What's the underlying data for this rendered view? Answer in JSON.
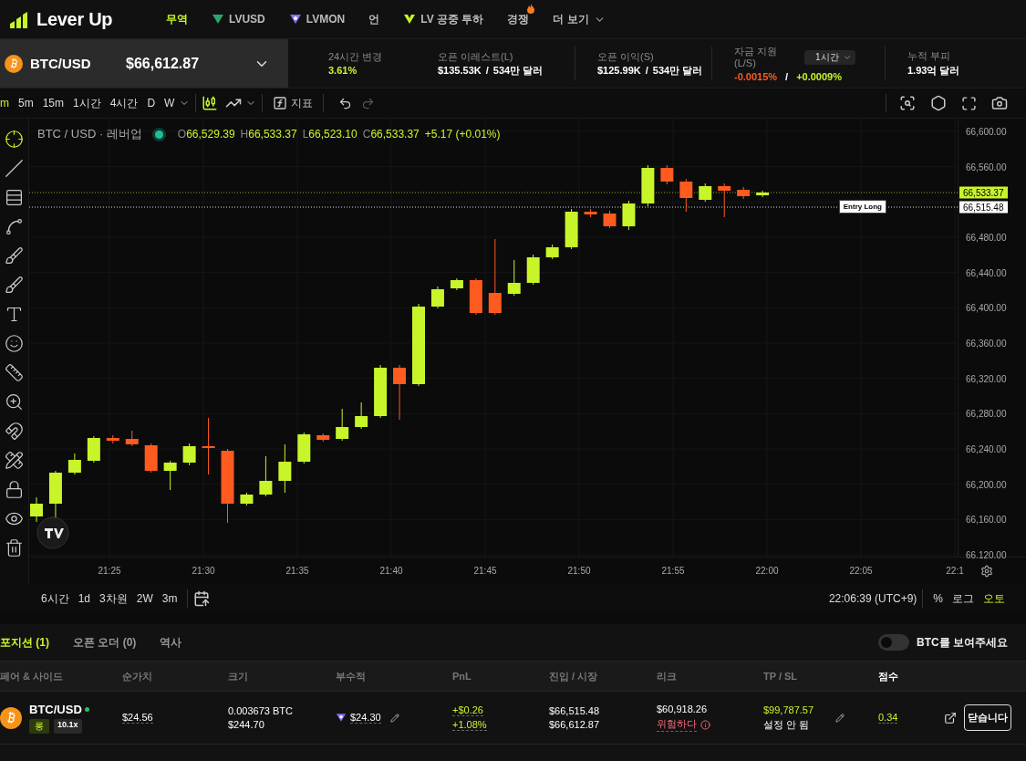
{
  "brand": {
    "name": "Lever Up"
  },
  "nav": [
    {
      "label": "무역",
      "kind": "text",
      "selected": true
    },
    {
      "label": "LVUSD",
      "kind": "usd-token",
      "selected": false
    },
    {
      "label": "LVMON",
      "kind": "mon-token",
      "selected": false
    },
    {
      "label": "언",
      "kind": "text",
      "selected": false
    },
    {
      "label": "LV 공중 투하",
      "kind": "airdrop",
      "selected": false
    },
    {
      "label": "경쟁",
      "kind": "hot",
      "selected": false
    },
    {
      "label": "더 보기",
      "kind": "menu",
      "selected": false
    }
  ],
  "ticker": {
    "pair": "BTC/USD",
    "price": "$66,612.87"
  },
  "stats": [
    {
      "kind": "change",
      "label": "24시간 변경",
      "value": "3.61%"
    },
    {
      "kind": "ratio",
      "label": "오픈 이레스트(L)",
      "value": "$135.53K",
      "sep": "/",
      "total": "534만 달러"
    },
    {
      "kind": "ratio",
      "label": "오픈 이익(S)",
      "value": "$125.99K",
      "sep": "/",
      "total": "534만 달러"
    },
    {
      "kind": "funding",
      "label": "자금 지원 (L/S)",
      "select": "1시간",
      "long": "-0.0015%",
      "sep": "/",
      "short": "+0.0009%"
    },
    {
      "kind": "plain",
      "label": "누적 부피",
      "value": "1.93억 달러"
    }
  ],
  "toolbar": {
    "intervals": [
      {
        "label": "m",
        "selected": true
      },
      {
        "label": "5m",
        "selected": false
      },
      {
        "label": "15m",
        "selected": false
      },
      {
        "label": "1시간",
        "selected": false
      },
      {
        "label": "4시간",
        "selected": false
      },
      {
        "label": "D",
        "selected": false
      },
      {
        "label": "W",
        "selected": false
      }
    ],
    "indicators": "지표"
  },
  "chart": {
    "title": "BTC / USD · 레버업",
    "ohlc": [
      {
        "key": "O",
        "value": "66,529.39"
      },
      {
        "key": "H",
        "value": "66,533.37"
      },
      {
        "key": "L",
        "value": "66,523.10"
      },
      {
        "key": "C",
        "value": "66,533.37"
      }
    ],
    "change": "+5.17 (+0.01%)",
    "price_labels": [
      "66,600.00",
      "66,560.00",
      "66,480.00",
      "66,440.00",
      "66,400.00",
      "66,360.00",
      "66,320.00",
      "66,280.00",
      "66,240.00",
      "66,200.00",
      "66,160.00",
      "66.120.00"
    ],
    "price_tags": [
      {
        "kind": "last",
        "value": "66,533.37"
      },
      {
        "kind": "entry",
        "value": "66,515.48"
      }
    ],
    "entry_label": "Entry Long",
    "time_labels": [
      "21:25",
      "21:30",
      "21:35",
      "21:40",
      "21:45",
      "21:50",
      "21:55",
      "22:00",
      "22:05",
      "22:1"
    ]
  },
  "range_bar": {
    "ranges": [
      "6시간",
      "1d",
      "3차원",
      "2W",
      "3m"
    ],
    "clock": "22:06:39 (UTC+9)",
    "options": [
      {
        "label": "%",
        "selected": false
      },
      {
        "label": "로그",
        "selected": false
      },
      {
        "label": "오토",
        "selected": true
      }
    ]
  },
  "positions": {
    "tabs": [
      {
        "label": "포지션 (1)",
        "selected": true
      },
      {
        "label": "오픈 오더 (0)",
        "selected": false
      },
      {
        "label": "역사",
        "selected": false
      }
    ],
    "toggle": {
      "label": "BTC를 보여주세요",
      "on": false
    },
    "columns": [
      {
        "label": "페어 & 사이드",
        "sorted": false
      },
      {
        "label": "순가치",
        "sorted": false
      },
      {
        "label": "크기",
        "sorted": false
      },
      {
        "label": "부수적",
        "sorted": false
      },
      {
        "label": "PnL",
        "sorted": false
      },
      {
        "label": "진입 / 시장",
        "sorted": false
      },
      {
        "label": "리크",
        "sorted": false
      },
      {
        "label": "TP / SL",
        "sorted": false
      },
      {
        "label": "점수",
        "sorted": true
      }
    ],
    "rows": [
      {
        "pair": "BTC/USD",
        "online": true,
        "side": "롱",
        "leverage": "10.1x",
        "net": "$24.56",
        "size": "0.003673 BTC",
        "size_usd": "$244.70",
        "collateral": "$24.30",
        "pnl": "+$0.26",
        "pnl_pct": "+1.08%",
        "entry": "$66,515.48",
        "market": "$66,612.87",
        "liq": "$60,918.26",
        "risk": "위험하다",
        "tp": "$99,787.57",
        "sl": "설정 안 됨",
        "score": "0.34",
        "close": "닫습니다"
      }
    ]
  }
}
